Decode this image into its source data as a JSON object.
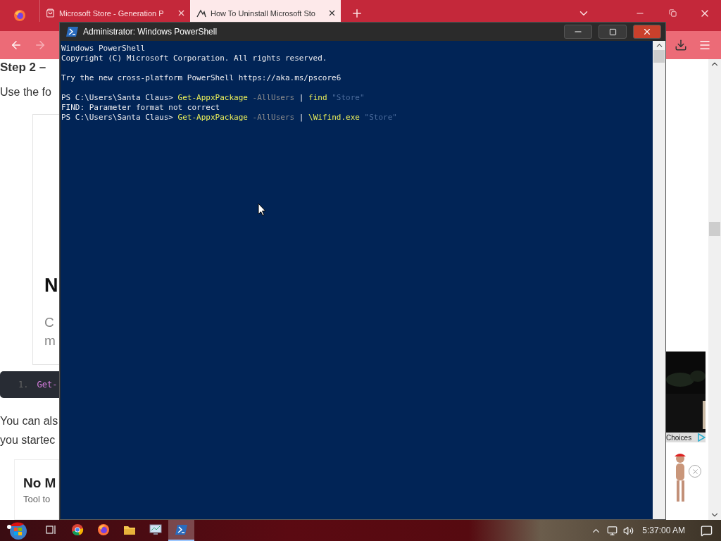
{
  "browser": {
    "tabs": [
      {
        "title": "Microsoft Store - Generation P",
        "selected": false
      },
      {
        "title": "How To Uninstall Microsoft Sto",
        "selected": true
      }
    ]
  },
  "page": {
    "heading": "Step 2 –",
    "intro": "Use the fo",
    "card": {
      "title": "N",
      "line_1": "C",
      "line_2": "m"
    },
    "code": {
      "line_number": "1.",
      "text": "Get-"
    },
    "paragraph_lines": [
      "You can als",
      "you startec"
    ],
    "promo": {
      "title": "No M",
      "subtitle": "Tool to"
    },
    "ad": {
      "label": "Choices"
    }
  },
  "console_window": {
    "title": "Administrator: Windows PowerShell",
    "lines": [
      {
        "kind": "text",
        "segments": [
          {
            "kind": "plain",
            "text": "Windows PowerShell"
          }
        ]
      },
      {
        "kind": "text",
        "segments": [
          {
            "kind": "plain",
            "text": "Copyright (C) Microsoft Corporation. All rights reserved."
          }
        ]
      },
      {
        "kind": "blank"
      },
      {
        "kind": "text",
        "segments": [
          {
            "kind": "plain",
            "text": "Try the new cross-platform PowerShell https://aka.ms/pscore6"
          }
        ]
      },
      {
        "kind": "blank"
      },
      {
        "kind": "text",
        "segments": [
          {
            "kind": "plain",
            "text": "PS C:\\Users\\Santa Claus> "
          },
          {
            "kind": "command",
            "text": "Get-AppxPackage"
          },
          {
            "kind": "parameter",
            "text": " -AllUsers "
          },
          {
            "kind": "plain",
            "text": "| "
          },
          {
            "kind": "command",
            "text": "find"
          },
          {
            "kind": "string",
            "text": " \"Store\""
          }
        ]
      },
      {
        "kind": "text",
        "segments": [
          {
            "kind": "plain",
            "text": "FIND: Parameter format not correct"
          }
        ]
      },
      {
        "kind": "text",
        "segments": [
          {
            "kind": "plain",
            "text": "PS C:\\Users\\Santa Claus> "
          },
          {
            "kind": "command",
            "text": "Get-AppxPackage"
          },
          {
            "kind": "parameter",
            "text": " -AllUsers "
          },
          {
            "kind": "plain",
            "text": "| "
          },
          {
            "kind": "command",
            "text": "\\Wifind.exe"
          },
          {
            "kind": "string",
            "text": " \"Store\""
          }
        ]
      }
    ]
  },
  "taskbar": {
    "apps": [
      {
        "kind": "taskview",
        "selected": false
      },
      {
        "kind": "chrome",
        "selected": false
      },
      {
        "kind": "firefox",
        "selected": false
      },
      {
        "kind": "files",
        "selected": false
      },
      {
        "kind": "monitor",
        "selected": false
      },
      {
        "kind": "powershell",
        "selected": true
      }
    ],
    "clock": "5:37:00 AM"
  }
}
